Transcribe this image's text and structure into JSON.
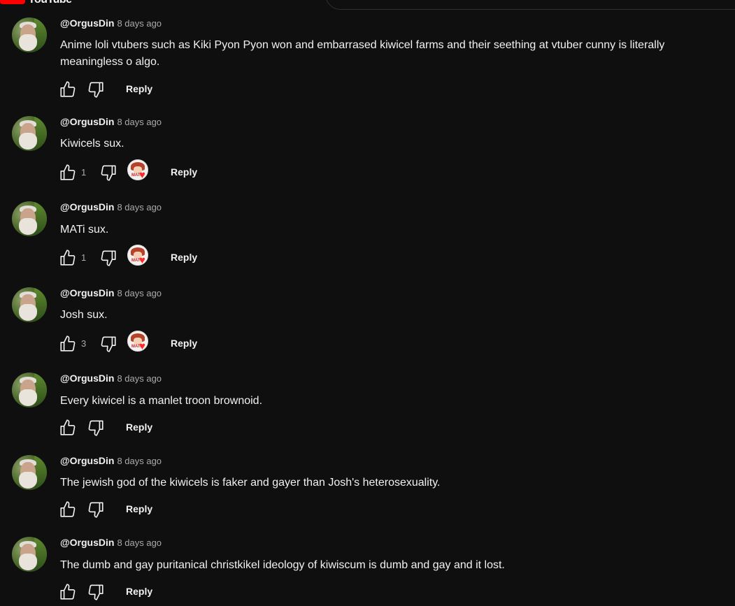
{
  "header": {
    "wordmark": "YouTube"
  },
  "icons": {
    "like": "thumbs-up-icon",
    "dislike": "thumbs-down-icon",
    "heart": "creator-heart-icon"
  },
  "colors": {
    "background": "#0f0f0f",
    "text": "#f1f1f1",
    "muted": "#aaaaaa",
    "heart": "#ff2a2a",
    "brand": "#ff0000"
  },
  "comments": [
    {
      "author": "@OrgusDin",
      "time": "8 days ago",
      "text": "Anime loli vtubers such as Kiki Pyon Pyon won and embarrased kiwicel farms and their seething at vtuber cunny is literally meaningless o algo.",
      "likes": "",
      "hearted": false,
      "reply_label": "Reply"
    },
    {
      "author": "@OrgusDin",
      "time": "8 days ago",
      "text": "Kiwicels sux.",
      "likes": "1",
      "hearted": true,
      "reply_label": "Reply"
    },
    {
      "author": "@OrgusDin",
      "time": "8 days ago",
      "text": "MATi sux.",
      "likes": "1",
      "hearted": true,
      "reply_label": "Reply"
    },
    {
      "author": "@OrgusDin",
      "time": "8 days ago",
      "text": "Josh sux.",
      "likes": "3",
      "hearted": true,
      "reply_label": "Reply"
    },
    {
      "author": "@OrgusDin",
      "time": "8 days ago",
      "text": "Every kiwicel is a manlet troon brownoid.",
      "likes": "",
      "hearted": false,
      "reply_label": "Reply"
    },
    {
      "author": "@OrgusDin",
      "time": "8 days ago",
      "text": "The jewish god of the kiwicels is faker and gayer than Josh's heterosexuality.",
      "likes": "",
      "hearted": false,
      "reply_label": "Reply"
    },
    {
      "author": "@OrgusDin",
      "time": "8 days ago",
      "text": "The dumb and gay puritanical christkikel ideology of kiwiscum is dumb and gay and it lost.",
      "likes": "",
      "hearted": false,
      "reply_label": "Reply"
    }
  ],
  "badge": {
    "creator_tag": "MATi"
  }
}
